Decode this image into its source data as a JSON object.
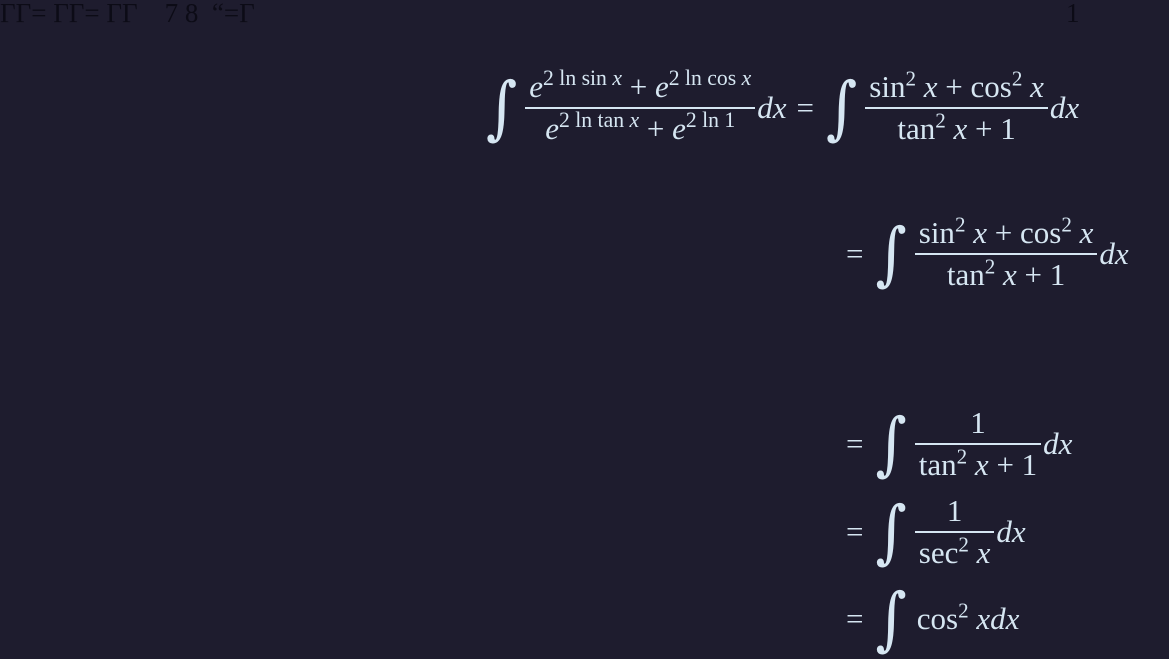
{
  "header": {
    "garbled_text": "ΓΓ= ΓΓ= ΓΓ    7 8  “=Γ",
    "page_number": "1"
  },
  "lines": [
    {
      "lhs_numerator": "e^{2 ln sin x} + e^{2 ln cos x}",
      "lhs_denominator": "e^{2 ln tan x} + e^{2 ln 1}",
      "rhs_numerator": "sin² x + cos² x",
      "rhs_denominator": "tan² x + 1",
      "differential": "dx"
    },
    {
      "rhs_numerator": "sin² x + cos² x",
      "rhs_denominator": "tan² x + 1",
      "differential": "dx"
    },
    {
      "rhs_numerator": "1",
      "rhs_denominator": "tan² x + 1",
      "differential": "dx"
    },
    {
      "rhs_numerator": "1",
      "rhs_denominator": "sec² x",
      "differential": "dx"
    },
    {
      "rhs_integrand": "cos² xdx"
    }
  ]
}
